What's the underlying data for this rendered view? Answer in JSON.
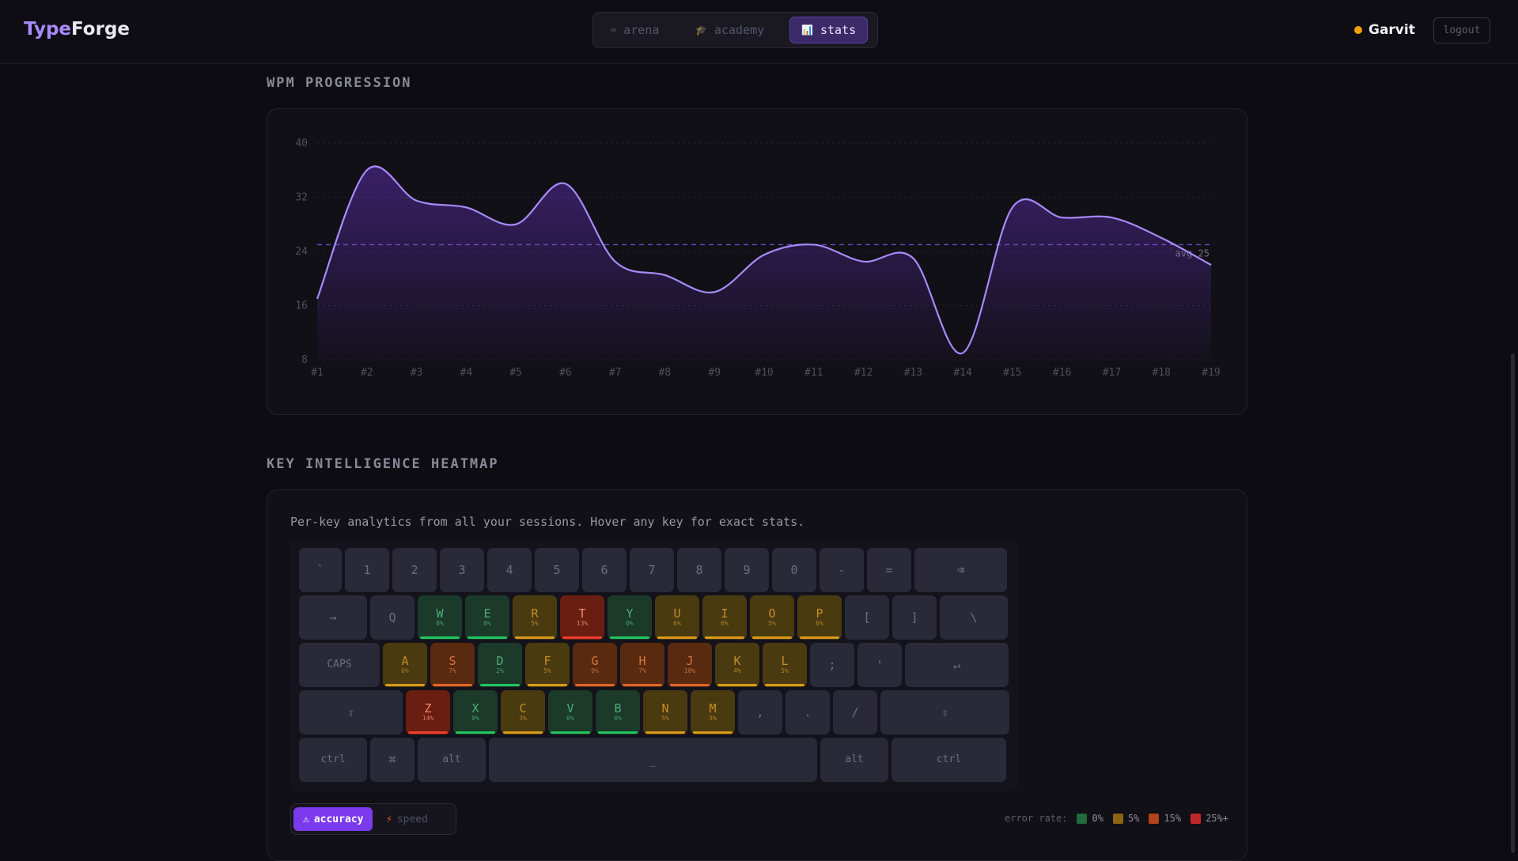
{
  "app": {
    "brand_a": "Type",
    "brand_b": "Forge"
  },
  "nav": {
    "tabs": [
      {
        "label": "arena",
        "icon": "keyboard-icon"
      },
      {
        "label": "academy",
        "icon": "graduation-cap-icon"
      },
      {
        "label": "stats",
        "icon": "bar-chart-icon",
        "active": true
      }
    ]
  },
  "user": {
    "name": "Garvit",
    "logout": "logout",
    "status_color": "#f59e0b"
  },
  "wpm": {
    "title": "WPM PROGRESSION"
  },
  "chart_data": {
    "type": "line",
    "title": "",
    "categories": [
      "#1",
      "#2",
      "#3",
      "#4",
      "#5",
      "#6",
      "#7",
      "#8",
      "#9",
      "#10",
      "#11",
      "#12",
      "#13",
      "#14",
      "#15",
      "#16",
      "#17",
      "#18",
      "#19"
    ],
    "values": [
      17,
      36,
      31.5,
      30.5,
      28,
      34,
      22.5,
      20.5,
      18,
      23.5,
      25,
      22.5,
      23,
      9,
      30.5,
      29,
      29,
      26,
      22
    ],
    "yticks": [
      40,
      32,
      24,
      16,
      8
    ],
    "ylim": [
      8,
      40
    ],
    "average": {
      "value": 25,
      "label": "avg 25"
    },
    "color": "#a78bfa"
  },
  "heatmap": {
    "title": "KEY INTELLIGENCE HEATMAP",
    "description": "Per-key analytics from all your sessions. Hover any key for exact stats.",
    "rows": [
      [
        {
          "k": "`"
        },
        {
          "k": "1"
        },
        {
          "k": "2"
        },
        {
          "k": "3"
        },
        {
          "k": "4"
        },
        {
          "k": "5"
        },
        {
          "k": "6"
        },
        {
          "k": "7"
        },
        {
          "k": "8"
        },
        {
          "k": "9"
        },
        {
          "k": "0"
        },
        {
          "k": "-"
        },
        {
          "k": "="
        },
        {
          "k": "⌫"
        }
      ],
      [
        {
          "k": "→"
        },
        {
          "k": "Q"
        },
        {
          "k": "W",
          "p": "0%",
          "s": "ok"
        },
        {
          "k": "E",
          "p": "0%",
          "s": "ok"
        },
        {
          "k": "R",
          "p": "5%",
          "s": "warn"
        },
        {
          "k": "T",
          "p": "13%",
          "s": "bad"
        },
        {
          "k": "Y",
          "p": "0%",
          "s": "ok"
        },
        {
          "k": "U",
          "p": "6%",
          "s": "warn"
        },
        {
          "k": "I",
          "p": "6%",
          "s": "warn"
        },
        {
          "k": "O",
          "p": "5%",
          "s": "warn"
        },
        {
          "k": "P",
          "p": "6%",
          "s": "warn"
        },
        {
          "k": "["
        },
        {
          "k": "]"
        },
        {
          "k": "\\"
        }
      ],
      [
        {
          "k": "CAPS"
        },
        {
          "k": "A",
          "p": "6%",
          "s": "warn"
        },
        {
          "k": "S",
          "p": "7%",
          "s": "hot"
        },
        {
          "k": "D",
          "p": "2%",
          "s": "ok"
        },
        {
          "k": "F",
          "p": "5%",
          "s": "warn"
        },
        {
          "k": "G",
          "p": "9%",
          "s": "hot"
        },
        {
          "k": "H",
          "p": "7%",
          "s": "hot"
        },
        {
          "k": "J",
          "p": "10%",
          "s": "hot"
        },
        {
          "k": "K",
          "p": "4%",
          "s": "warn"
        },
        {
          "k": "L",
          "p": "5%",
          "s": "warn"
        },
        {
          "k": ";"
        },
        {
          "k": "'"
        },
        {
          "k": "↵"
        }
      ],
      [
        {
          "k": "⇧"
        },
        {
          "k": "Z",
          "p": "14%",
          "s": "bad"
        },
        {
          "k": "X",
          "p": "0%",
          "s": "ok"
        },
        {
          "k": "C",
          "p": "3%",
          "s": "warn"
        },
        {
          "k": "V",
          "p": "0%",
          "s": "ok"
        },
        {
          "k": "B",
          "p": "0%",
          "s": "ok"
        },
        {
          "k": "N",
          "p": "5%",
          "s": "warn"
        },
        {
          "k": "M",
          "p": "3%",
          "s": "warn"
        },
        {
          "k": ","
        },
        {
          "k": "."
        },
        {
          "k": "/"
        },
        {
          "k": "⇧"
        }
      ],
      [
        {
          "k": "ctrl"
        },
        {
          "k": "⌘"
        },
        {
          "k": "alt"
        },
        {
          "k": "_"
        },
        {
          "k": "alt"
        },
        {
          "k": "ctrl"
        }
      ]
    ],
    "modes": [
      {
        "label": "accuracy",
        "icon": "warning-icon",
        "active": true
      },
      {
        "label": "speed",
        "icon": "lightning-icon"
      }
    ],
    "legend": {
      "title": "error rate:",
      "items": [
        {
          "label": "0%",
          "color": "#1f6b3d"
        },
        {
          "label": "5%",
          "color": "#8a6412"
        },
        {
          "label": "15%",
          "color": "#b2431a"
        },
        {
          "label": "25%+",
          "color": "#c0262a"
        }
      ]
    },
    "scale_colors": {
      "ok": "#22c55e",
      "warn": "#d99a1a",
      "hot": "#e0652a",
      "bad": "#ef3e2a"
    }
  }
}
